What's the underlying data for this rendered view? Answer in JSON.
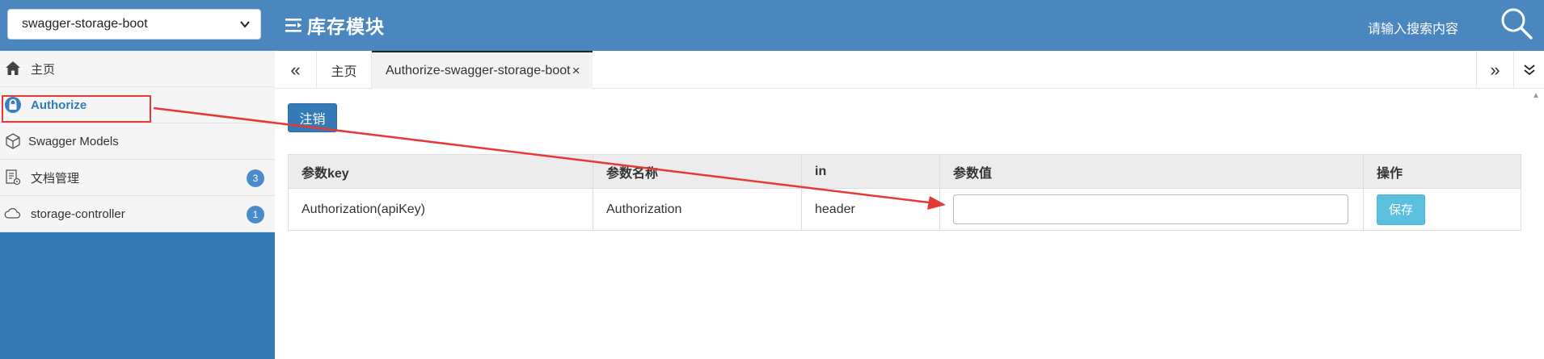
{
  "header": {
    "service_select_value": "swagger-storage-boot",
    "title": "库存模块",
    "search_placeholder": "请输入搜索内容"
  },
  "sidebar": {
    "items": [
      {
        "label": "主页",
        "icon": "home-icon"
      },
      {
        "label": "Authorize",
        "icon": "lock-icon",
        "active": true
      },
      {
        "label": "Swagger Models",
        "icon": "cube-icon"
      },
      {
        "label": "文档管理",
        "icon": "document-settings-icon",
        "badge": "3"
      },
      {
        "label": "storage-controller",
        "icon": "cloud-icon",
        "badge": "1"
      }
    ]
  },
  "tabs": {
    "home": "主页",
    "authorize": "Authorize-swagger-storage-boot",
    "close_glyph": "×",
    "prev_glyph": "«",
    "next_glyph": "»"
  },
  "content": {
    "logout_label": "注销",
    "table": {
      "headers": [
        "参数key",
        "参数名称",
        "in",
        "参数值",
        "操作"
      ],
      "row": {
        "key": "Authorization(apiKey)",
        "name": "Authorization",
        "in": "header",
        "value": "",
        "action_label": "保存"
      }
    }
  },
  "colors": {
    "header_bg": "#4a87bf",
    "sidebar_bg": "#337ab7",
    "active_item": "#2f7bbd",
    "annotation_red": "#e53935",
    "save_button": "#5bc0de"
  }
}
